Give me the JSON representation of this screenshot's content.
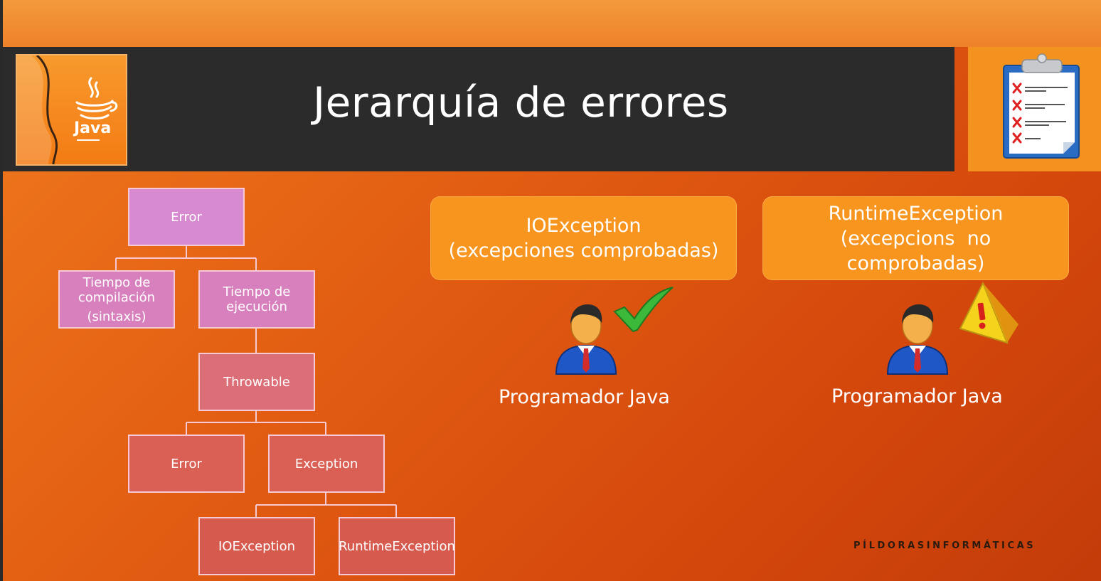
{
  "slide": {
    "title": "Jerarquía de errores",
    "brand": "PÍLDORASINFORMÁTICAS"
  },
  "java_logo": {
    "label": "Java"
  },
  "hierarchy": {
    "error_top": "Error",
    "tiempo_compilacion_1": "Tiempo de",
    "tiempo_compilacion_2": "compilación",
    "tiempo_compilacion_3": "(sintaxis)",
    "tiempo_ejecucion_1": "Tiempo de",
    "tiempo_ejecucion_2": "ejecución",
    "throwable": "Throwable",
    "error": "Error",
    "exception": "Exception",
    "ioexception": "IOException",
    "runtimeexception": "RuntimeException"
  },
  "callouts": {
    "io_line1": "IOException",
    "io_line2": "(excepciones comprobadas)",
    "rt_line1": "RuntimeException",
    "rt_line2": "(excepcions  no",
    "rt_line3": "comprobadas)"
  },
  "programmers": {
    "left_label": "Programador Java",
    "right_label": "Programador Java"
  },
  "colors": {
    "accent_orange": "#f7951e",
    "title_bar": "#2b2b2b",
    "check_green": "#3cb83a",
    "warning_yellow": "#f5d21c"
  }
}
